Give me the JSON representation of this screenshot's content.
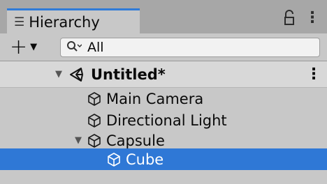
{
  "panel": {
    "tab_icon": "list-icon",
    "title": "Hierarchy"
  },
  "toolbar": {
    "add_label": "+",
    "search_placeholder": "All"
  },
  "scene": {
    "name": "Untitled*",
    "icon": "unity-logo-icon"
  },
  "objects": [
    {
      "label": "Main Camera",
      "icon": "cube-icon",
      "depth": 1,
      "expandable": false,
      "selected": false
    },
    {
      "label": "Directional Light",
      "icon": "cube-icon",
      "depth": 1,
      "expandable": false,
      "selected": false
    },
    {
      "label": "Capsule",
      "icon": "cube-icon",
      "depth": 1,
      "expandable": true,
      "selected": false
    },
    {
      "label": "Cube",
      "icon": "cube-icon",
      "depth": 2,
      "expandable": false,
      "selected": true
    }
  ],
  "colors": {
    "selection": "#2f78d6",
    "tab_accent": "#2f7bd8",
    "panel_bg": "#c8c8c8"
  }
}
